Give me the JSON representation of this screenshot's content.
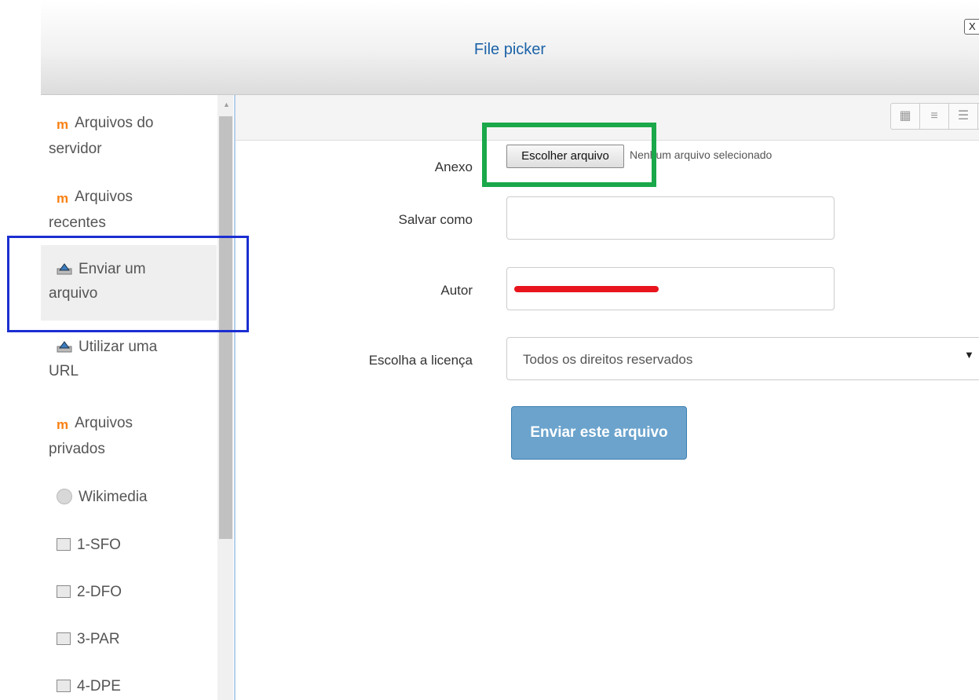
{
  "dialog": {
    "title": "File picker",
    "close_label": "X"
  },
  "sidebar": {
    "items": [
      {
        "label_line1": "Arquivos do",
        "label_line2": "servidor",
        "icon": "moodle-icon"
      },
      {
        "label_line1": "Arquivos",
        "label_line2": "recentes",
        "icon": "moodle-icon"
      },
      {
        "label_line1": "Enviar um",
        "label_line2": "arquivo",
        "icon": "upload-icon",
        "active": true
      },
      {
        "label_line1": "Utilizar uma",
        "label_line2": "URL",
        "icon": "upload-icon"
      },
      {
        "label_line1": "Arquivos",
        "label_line2": "privados",
        "icon": "moodle-icon"
      },
      {
        "label_line1": "Wikimedia",
        "icon": "wikimedia-icon"
      },
      {
        "label_line1": "1-SFO",
        "icon": "repository-icon"
      },
      {
        "label_line1": "2-DFO",
        "icon": "repository-icon"
      },
      {
        "label_line1": "3-PAR",
        "icon": "repository-icon"
      },
      {
        "label_line1": "4-DPE",
        "icon": "repository-icon"
      }
    ]
  },
  "form": {
    "attachment_label": "Anexo",
    "choose_file_label": "Escolher arquivo",
    "no_file_text": "Nenhum arquivo selecionado",
    "save_as_label": "Salvar como",
    "save_as_value": "",
    "author_label": "Autor",
    "license_label": "Escolha a licença",
    "license_value": "Todos os direitos reservados",
    "submit_label": "Enviar este arquivo"
  },
  "colors": {
    "title": "#1c63a8",
    "submit_button": "#6ba3cc",
    "highlight_green": "#1aa84a",
    "highlight_blue": "#1b2fd1",
    "redaction": "#e8151d"
  }
}
